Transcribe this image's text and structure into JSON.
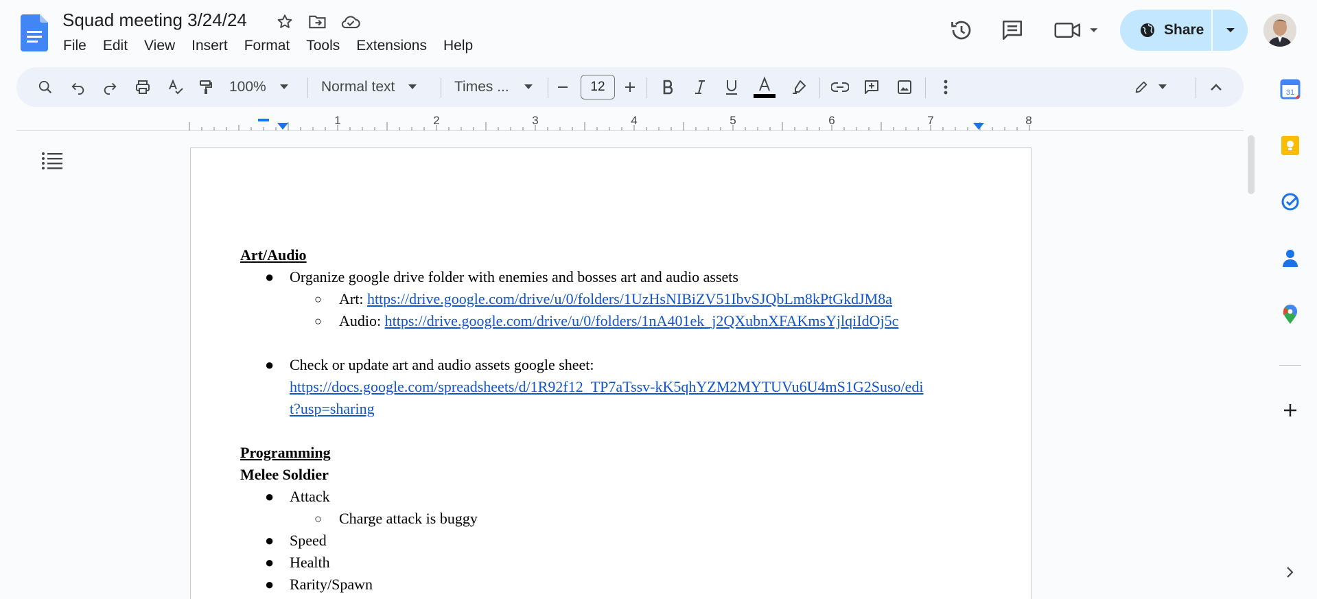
{
  "doc_title": "Squad meeting 3/24/24",
  "menu": [
    "File",
    "Edit",
    "View",
    "Insert",
    "Format",
    "Tools",
    "Extensions",
    "Help"
  ],
  "share_label": "Share",
  "toolbar": {
    "zoom": "100%",
    "style": "Normal text",
    "font": "Times ...",
    "font_size": "12"
  },
  "ruler_numbers": [
    "1",
    "2",
    "3",
    "4",
    "5",
    "6",
    "7",
    "8"
  ],
  "document": {
    "art_heading": "Art/Audio",
    "art_item1": "Organize google drive folder with enemies and bosses art and audio assets",
    "art_sub1_label": "Art: ",
    "art_sub1_link": "https://drive.google.com/drive/u/0/folders/1UzHsNIBiZV51IbvSJQbLm8kPtGkdJM8a",
    "art_sub2_label": "Audio: ",
    "art_sub2_link": "https://drive.google.com/drive/u/0/folders/1nA401ek_j2QXubnXFAKmsYjlqiIdOj5c",
    "art_item2": "Check or update art and audio assets google sheet:",
    "art_item2_link_line1": "https://docs.google.com/spreadsheets/d/1R92f12_TP7aTssv-kK5qhYZM2MYTUVu6U4mS1G2Suso/edi",
    "art_item2_link_line2": "t?usp=sharing",
    "prog_heading": "Programming",
    "melee_heading": "Melee Soldier",
    "melee_items": [
      "Attack",
      "Speed",
      "Health",
      "Rarity/Spawn"
    ],
    "attack_sub": "Charge attack is buggy"
  },
  "colors": {
    "accent": "#1a73e8",
    "share_bg": "#c2e7ff",
    "link": "#1155cc"
  }
}
